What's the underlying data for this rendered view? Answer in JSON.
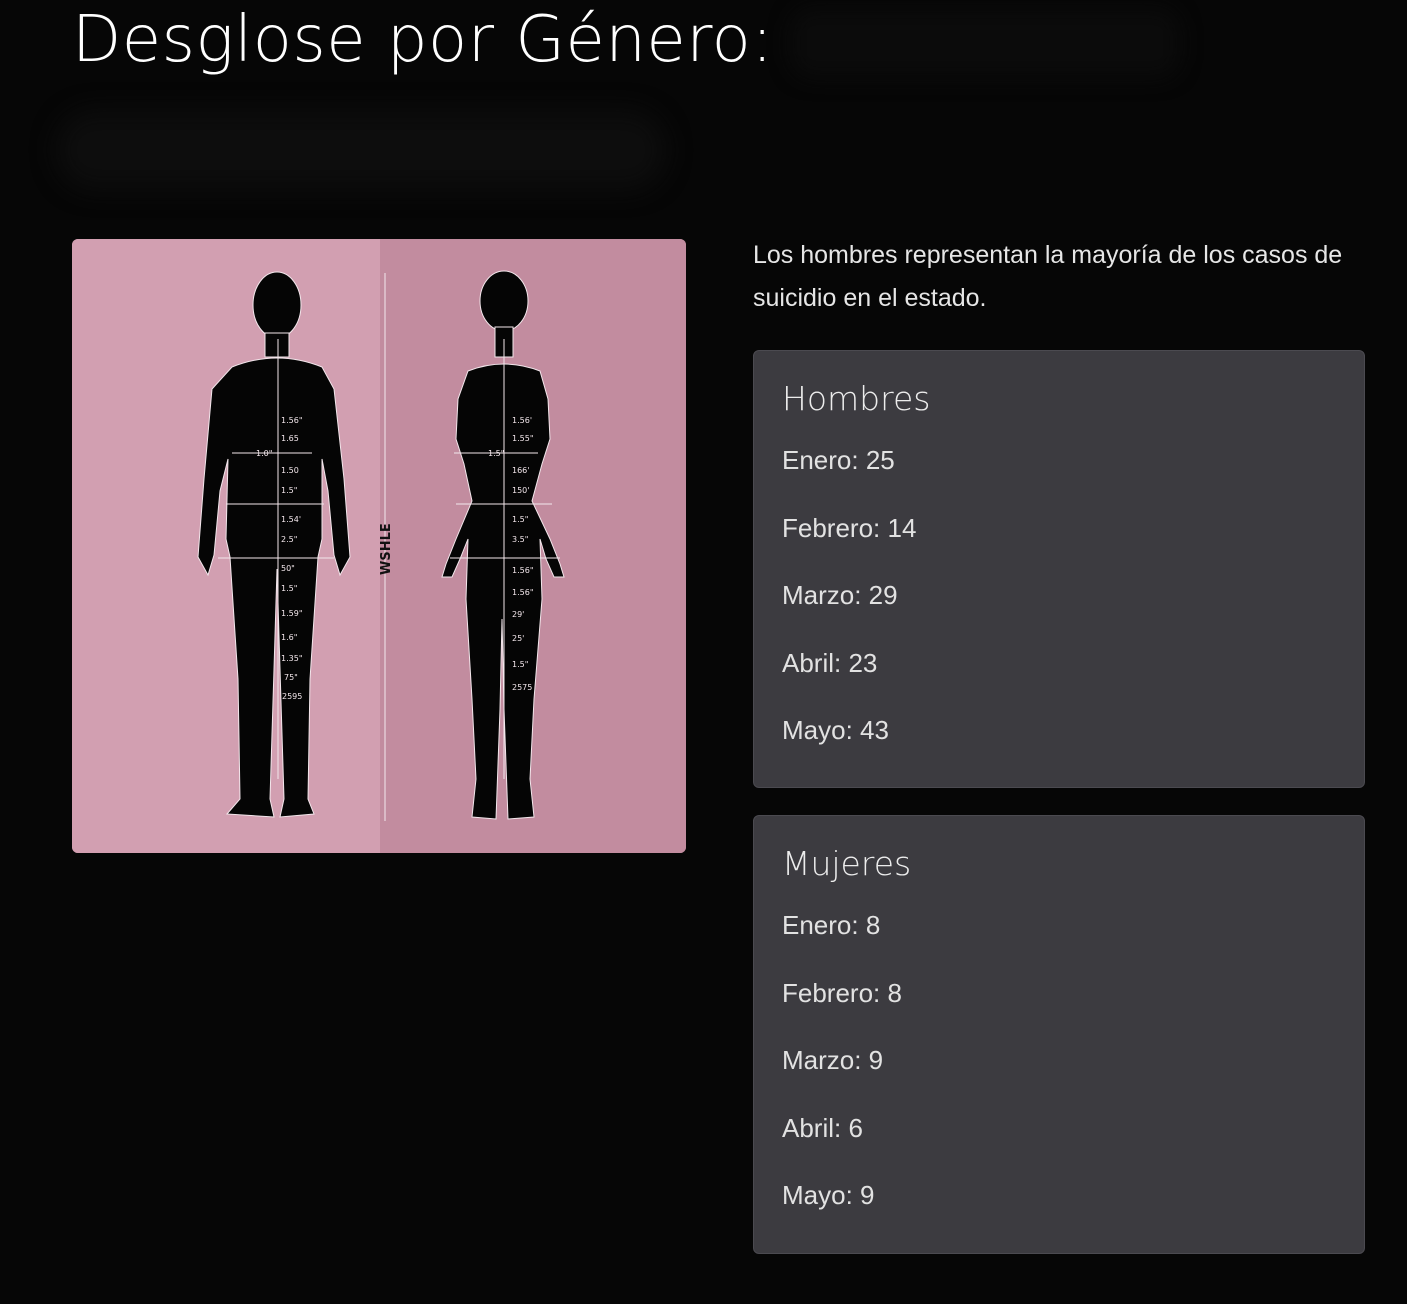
{
  "header": {
    "title": "Desglose por Género:"
  },
  "figure": {
    "alt": "Siluetas de cuerpo masculino y femenino con medidas",
    "vertical_label": "WSHLE",
    "colors": {
      "background_left": "#d29fb1",
      "background_right": "#c28c9f",
      "silhouette": "#050505"
    },
    "male_measurements": [
      "1.56\"",
      "1.65",
      "1.50",
      "1.5\"",
      "1.54'",
      "2.5\"",
      "50\"",
      "1.5\"",
      "1.59\"",
      "1.6\"",
      "1.35\"",
      "75\"",
      "2595"
    ],
    "male_side_label": "1.0\"",
    "female_measurements": [
      "1.56'",
      "1.55\"",
      "166'",
      "150'",
      "1.5\"",
      "3.5\"",
      "1.56\"",
      "1.56\"",
      "29'",
      "25'",
      "1.5\"",
      "2575"
    ],
    "female_side_label": "1.5\""
  },
  "intro": {
    "text": "Los hombres representan la mayoría de los casos de suicidio en el estado."
  },
  "men": {
    "title": "Hombres",
    "items": [
      {
        "label": "Enero: 25"
      },
      {
        "label": "Febrero: 14"
      },
      {
        "label": "Marzo: 29"
      },
      {
        "label": "Abril: 23"
      },
      {
        "label": "Mayo: 43"
      }
    ]
  },
  "women": {
    "title": "Mujeres",
    "items": [
      {
        "label": "Enero: 8"
      },
      {
        "label": "Febrero: 8"
      },
      {
        "label": "Marzo: 9"
      },
      {
        "label": "Abril: 6"
      },
      {
        "label": "Mayo: 9"
      }
    ]
  }
}
